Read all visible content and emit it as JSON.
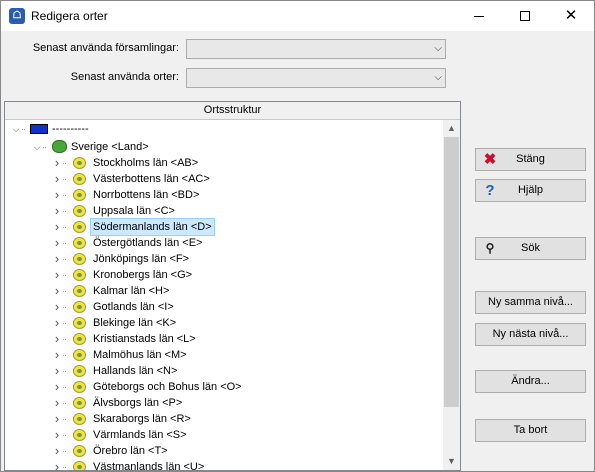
{
  "window": {
    "title": "Redigera orter",
    "app_icon": "app-icon"
  },
  "fields": {
    "recent_parishes_label": "Senast använda församlingar:",
    "recent_places_label": "Senast använda orter:",
    "recent_parishes_value": "",
    "recent_places_value": ""
  },
  "tree": {
    "header": "Ortsstruktur",
    "root_label": "----------",
    "country_label": "Sverige <Land>",
    "selected_index": 4,
    "items": [
      "Stockholms län <AB>",
      "Västerbottens län <AC>",
      "Norrbottens län <BD>",
      "Uppsala län <C>",
      "Södermanlands län <D>",
      "Östergötlands län <E>",
      "Jönköpings län <F>",
      "Kronobergs län <G>",
      "Kalmar län <H>",
      "Gotlands län <I>",
      "Blekinge län <K>",
      "Kristianstads län <L>",
      "Malmöhus län <M>",
      "Hallands län <N>",
      "Göteborgs och Bohus län <O>",
      "Älvsborgs län <P>",
      "Skaraborgs län <R>",
      "Värmlands län <S>",
      "Örebro län <T>",
      "Västmanlands län <U>"
    ]
  },
  "buttons": {
    "close": "Stäng",
    "help": "Hjälp",
    "search": "Sök",
    "new_same_level": "Ny samma nivå...",
    "new_next_level": "Ny nästa nivå...",
    "edit": "Ändra...",
    "delete": "Ta bort"
  },
  "colors": {
    "selection": "#cce8ff",
    "flag": "#1033c4",
    "close_icon": "#c8102e",
    "help_icon": "#1a5fb4"
  }
}
